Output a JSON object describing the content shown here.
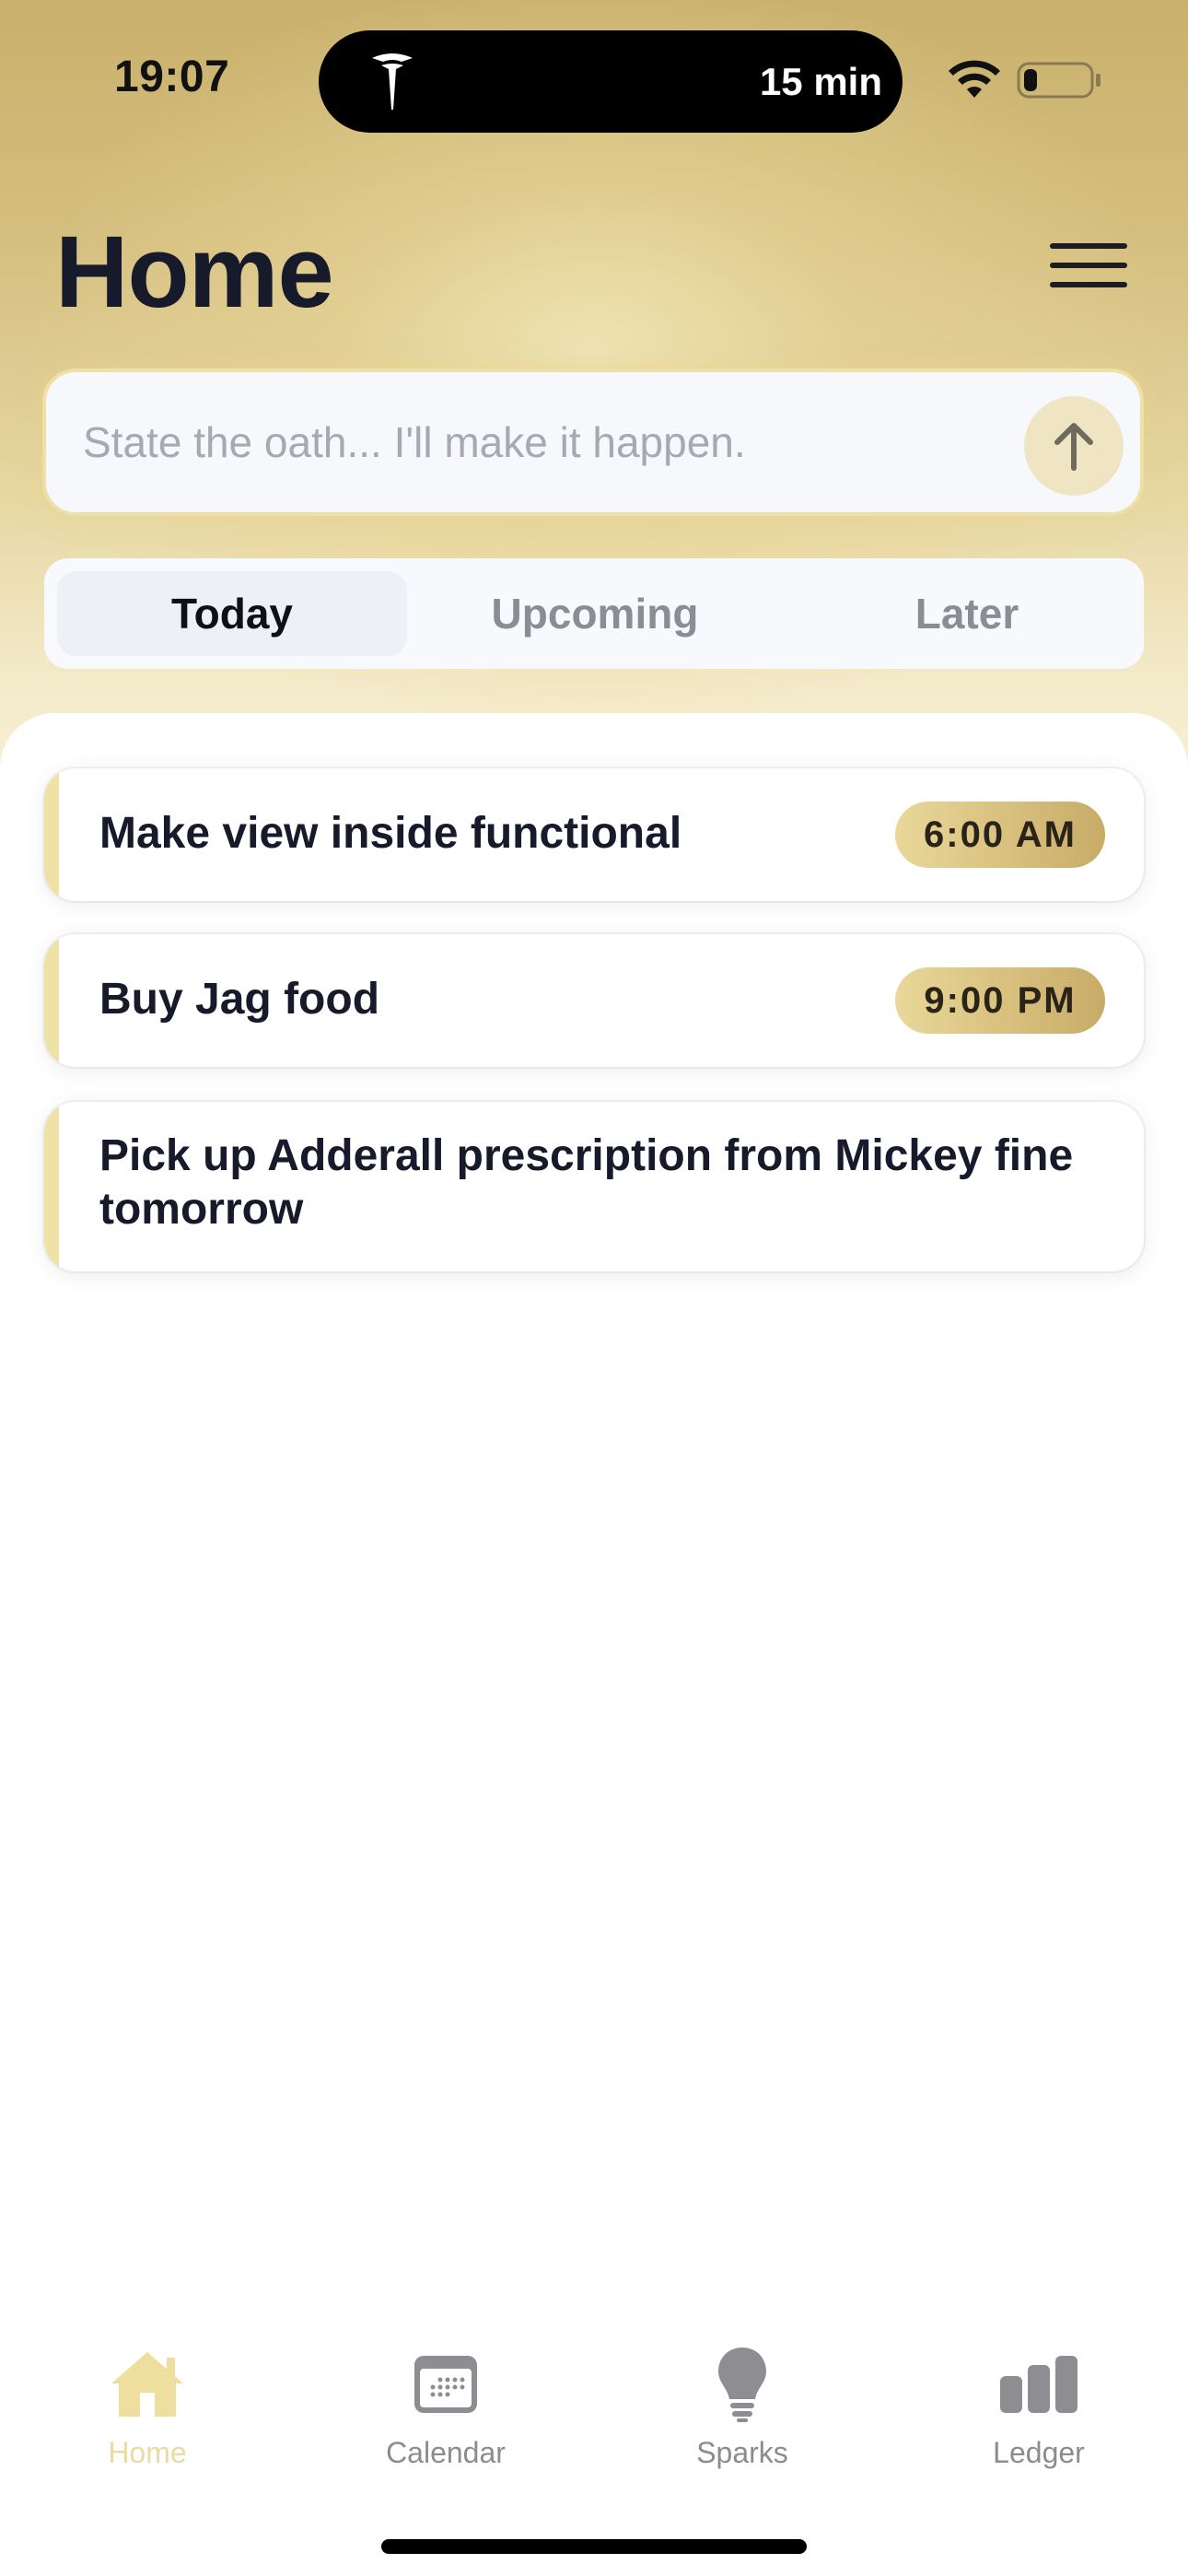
{
  "status_bar": {
    "time": "19:07",
    "island_logo": "tesla-logo-icon",
    "island_text": "15 min",
    "wifi": "wifi-icon",
    "battery": "battery-icon",
    "battery_level": 0.2
  },
  "header": {
    "title": "Home",
    "menu_icon": "hamburger-menu-icon"
  },
  "oath_input": {
    "placeholder": "State the oath... I'll make it happen.",
    "value": "",
    "submit_icon": "arrow-up-icon"
  },
  "tabs": [
    {
      "label": "Today",
      "active": true
    },
    {
      "label": "Upcoming",
      "active": false
    },
    {
      "label": "Later",
      "active": false
    }
  ],
  "tasks": [
    {
      "title": "Make view inside functional",
      "time": "6:00 AM"
    },
    {
      "title": "Buy Jag food",
      "time": "9:00 PM"
    },
    {
      "title": "Pick up Adderall prescription from Mickey fine tomorrow",
      "time": ""
    }
  ],
  "tab_bar": [
    {
      "label": "Home",
      "icon": "house-icon",
      "active": true
    },
    {
      "label": "Calendar",
      "icon": "calendar-icon",
      "active": false
    },
    {
      "label": "Sparks",
      "icon": "lightbulb-icon",
      "active": false
    },
    {
      "label": "Ledger",
      "icon": "bar-chart-icon",
      "active": false
    }
  ],
  "colors": {
    "accent_gold": "#d6bd7b",
    "accent_light": "#efe2a6",
    "text_dark": "#161a2a",
    "inactive_gray": "#8c8c90"
  }
}
